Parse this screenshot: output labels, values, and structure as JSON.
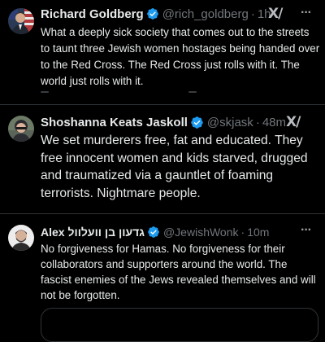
{
  "tweets": [
    {
      "name": "Richard Goldberg",
      "handle": "@rich_goldberg",
      "dot": "·",
      "time": "1h",
      "grok": "X/",
      "more": "···",
      "text": "What a deeply sick society that comes out to the streets to taunt three Jewish women hostages being handed over to the Red Cross. The Red Cross just rolls with it. The world just rolls with it."
    },
    {
      "name": "Shoshanna Keats Jaskoll",
      "handle": "@skjask",
      "dot": "·",
      "time": "48m",
      "grok": "X/",
      "more": "···",
      "text": "We set murderers free, fat and educated. They free innocent women and kids starved, drugged and traumatized via a gauntlet of foaming terrorists. Nightmare people."
    },
    {
      "name": "Alex גדעון בן וועלוול",
      "handle": "@JewishWonk",
      "dot": "·",
      "time": "10m",
      "grok": "X/",
      "more": "···",
      "text": "No forgiveness for Hamas. No forgiveness for their collaborators and supporters around the world. The fascist enemies of the Jews revealed themselves and will not be forgotten."
    }
  ],
  "colors": {
    "background": "#000000",
    "text": "#e7e9ea",
    "muted": "#71767b",
    "verified": "#1d9bf0",
    "divider": "#2f3336"
  },
  "icons": {
    "verified": "verified-badge-icon",
    "grok": "grok-icon",
    "more": "more-options-icon"
  }
}
